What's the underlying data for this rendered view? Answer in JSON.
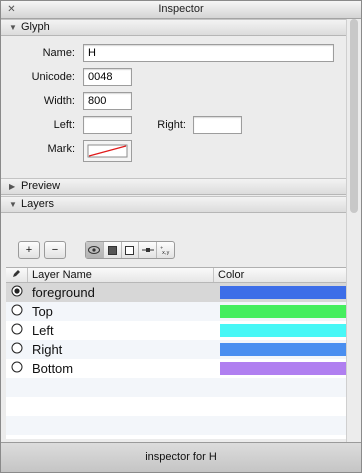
{
  "window": {
    "title": "Inspector"
  },
  "glyph_section": {
    "title": "Glyph",
    "name_label": "Name:",
    "name_value": "H",
    "unicode_label": "Unicode:",
    "unicode_value": "0048",
    "width_label": "Width:",
    "width_value": "800",
    "left_label": "Left:",
    "left_value": "",
    "right_label": "Right:",
    "right_value": "",
    "mark_label": "Mark:"
  },
  "preview_section": {
    "title": "Preview"
  },
  "layers_section": {
    "title": "Layers",
    "add_label": "+",
    "remove_label": "−",
    "columns": {
      "name": "Layer Name",
      "color": "Color"
    },
    "layers": [
      {
        "name": "foreground",
        "color": "#3d6ee8",
        "selected": true
      },
      {
        "name": "Top",
        "color": "#45ee5e",
        "selected": false
      },
      {
        "name": "Left",
        "color": "#47f7f6",
        "selected": false
      },
      {
        "name": "Right",
        "color": "#4a8ff0",
        "selected": false
      },
      {
        "name": "Bottom",
        "color": "#b07ff0",
        "selected": false
      }
    ]
  },
  "status": {
    "text": "inspector for H"
  }
}
